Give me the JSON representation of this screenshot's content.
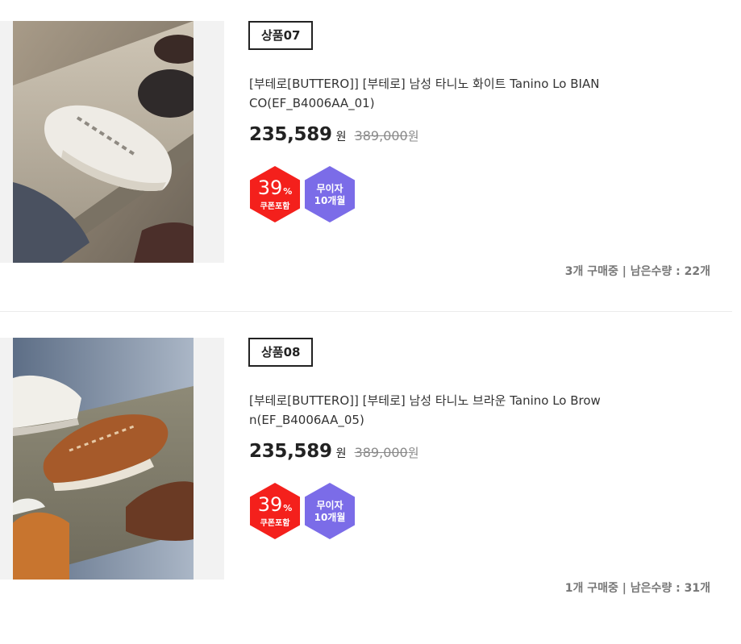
{
  "products": [
    {
      "tag": "상품07",
      "title": "[부테로[BUTTERO]] [부테로] 남성 타니노 화이트 Tanino Lo BIANCO(EF_B4006AA_01)",
      "price": "235,589",
      "price_unit": "원",
      "original_price": "389,000",
      "original_unit": "원",
      "discount_percent": "39",
      "discount_percent_sign": "%",
      "discount_label": "쿠폰포함",
      "interest_free_line1": "무이자",
      "interest_free_line2": "10개월",
      "stock_text": "3개 구매중 | 남은수량 : 22개",
      "image_icon": "white-sneaker-photo"
    },
    {
      "tag": "상품08",
      "title": "[부테로[BUTTERO]] [부테로] 남성 타니노 브라운 Tanino Lo Brown(EF_B4006AA_05)",
      "price": "235,589",
      "price_unit": "원",
      "original_price": "389,000",
      "original_unit": "원",
      "discount_percent": "39",
      "discount_percent_sign": "%",
      "discount_label": "쿠폰포함",
      "interest_free_line1": "무이자",
      "interest_free_line2": "10개월",
      "stock_text": "1개 구매중 | 남은수량 : 31개",
      "image_icon": "brown-sneaker-photo"
    }
  ],
  "colors": {
    "discount_badge": "#f4201c",
    "interest_badge": "#7b6ce8",
    "thumbnail_bg": "#f2f2f2"
  }
}
